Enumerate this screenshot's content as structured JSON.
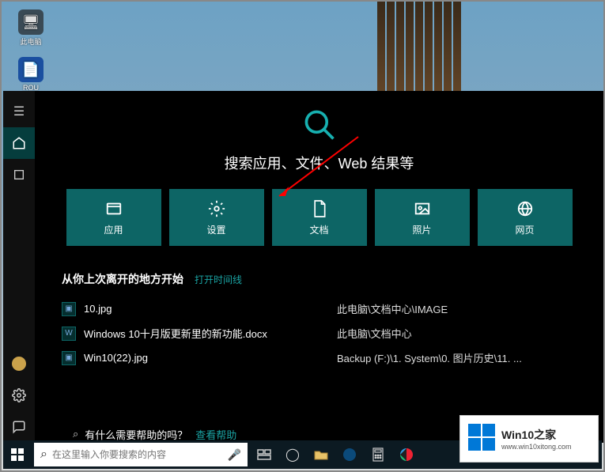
{
  "desktop": {
    "icon1_label": "此电脑",
    "icon2_label": "ROU"
  },
  "sidebar": {
    "items": [
      "menu",
      "home",
      "recent",
      "spacer",
      "account",
      "settings",
      "share"
    ]
  },
  "headline": "搜索应用、文件、Web 结果等",
  "categories": [
    {
      "label": "应用",
      "icon": "app"
    },
    {
      "label": "设置",
      "icon": "gear"
    },
    {
      "label": "文档",
      "icon": "doc"
    },
    {
      "label": "照片",
      "icon": "photo"
    },
    {
      "label": "网页",
      "icon": "globe"
    }
  ],
  "continue": {
    "title": "从你上次离开的地方开始",
    "timeline": "打开时间线"
  },
  "recent": [
    {
      "name": "10.jpg",
      "path": "此电脑\\文档中心\\IMAGE"
    },
    {
      "name": "Windows 10十月版更新里的新功能.docx",
      "path": "此电脑\\文档中心"
    },
    {
      "name": "Win10(22).jpg",
      "path": "Backup (F:)\\1. System\\0. 图片历史\\11. ..."
    }
  ],
  "partial": {
    "q": "有什么需要帮助的吗？",
    "link": "查看帮助"
  },
  "search": {
    "placeholder": "在这里输入你要搜索的内容"
  },
  "watermark": {
    "title": "Win10之家",
    "url": "www.win10xitong.com"
  }
}
